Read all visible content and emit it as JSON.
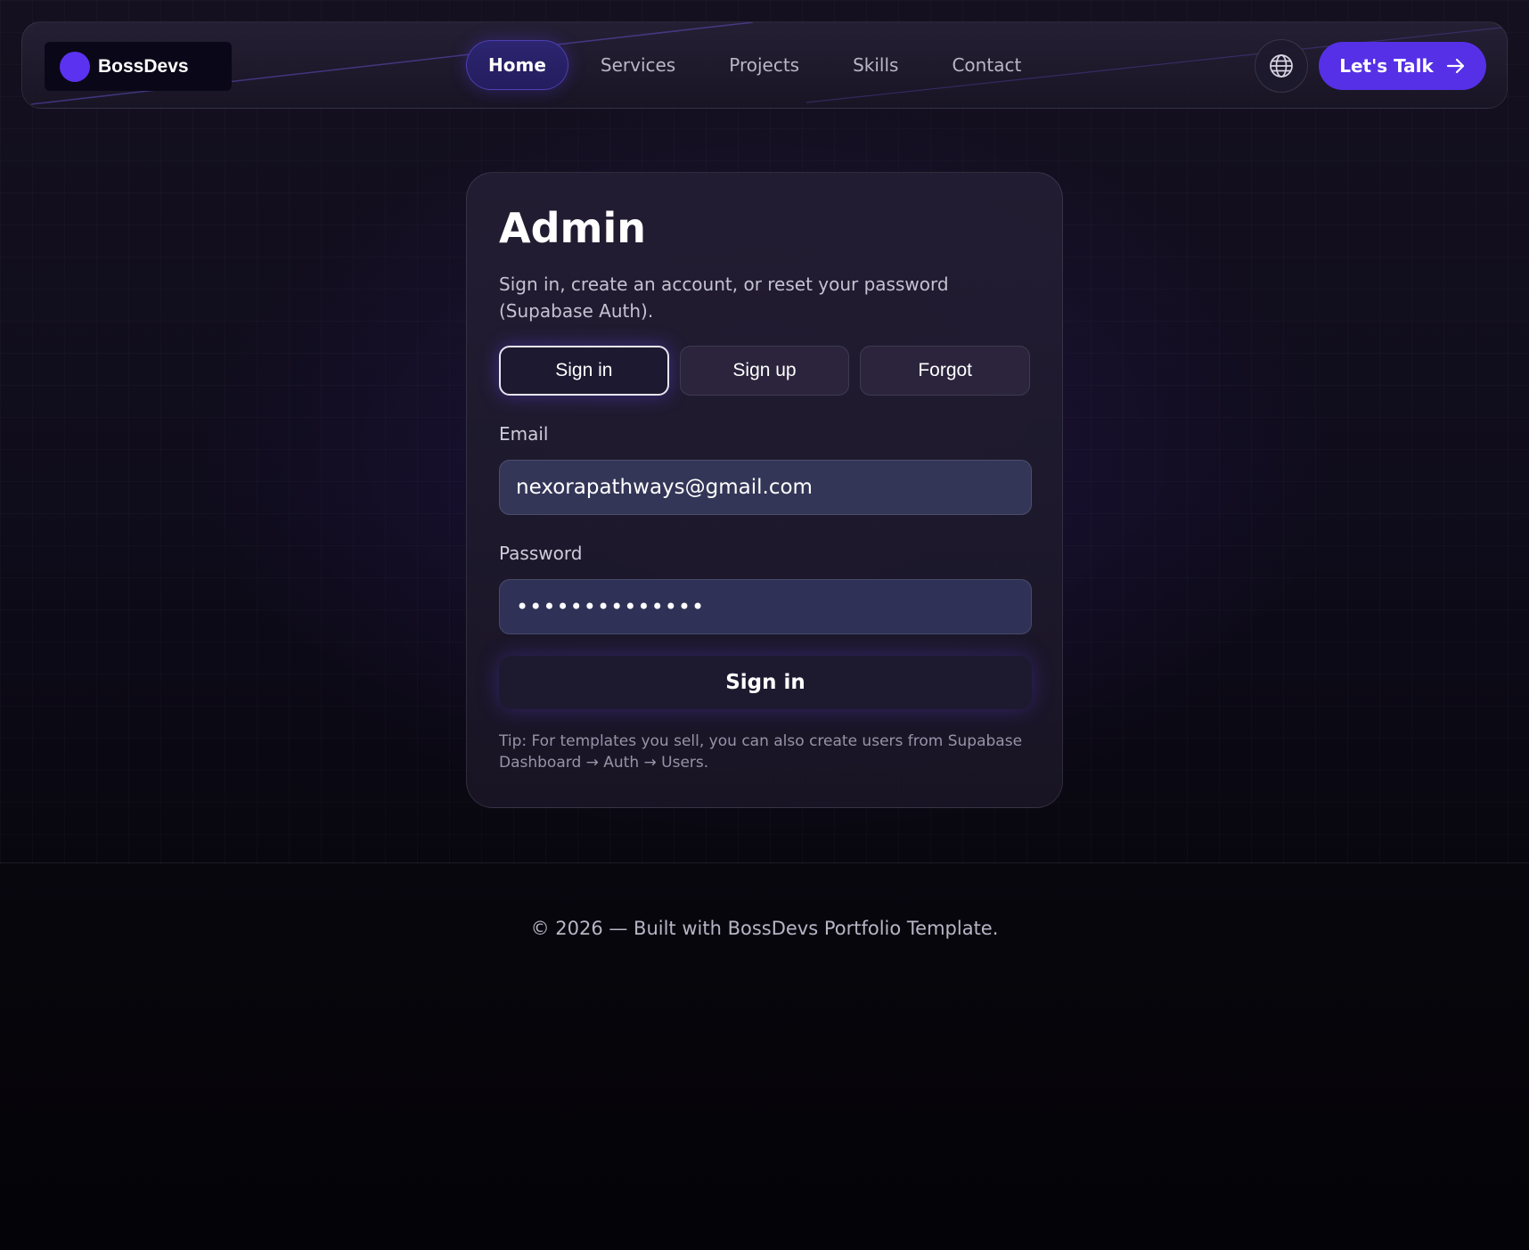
{
  "brand": {
    "name": "BossDevs",
    "accent": "#5a32ef"
  },
  "nav": {
    "links": [
      {
        "label": "Home",
        "active": true
      },
      {
        "label": "Services",
        "active": false
      },
      {
        "label": "Projects",
        "active": false
      },
      {
        "label": "Skills",
        "active": false
      },
      {
        "label": "Contact",
        "active": false
      }
    ],
    "language_icon": "globe-icon",
    "cta_label": "Let's Talk",
    "cta_icon": "arrow-right-icon",
    "cta_color": "#5630e6"
  },
  "auth": {
    "title": "Admin",
    "description": "Sign in, create an account, or reset your password (Supabase Auth).",
    "tabs": [
      {
        "label": "Sign in",
        "active": true
      },
      {
        "label": "Sign up",
        "active": false
      },
      {
        "label": "Forgot",
        "active": false
      }
    ],
    "email": {
      "label": "Email",
      "value": "nexorapathways@gmail.com"
    },
    "password": {
      "label": "Password",
      "value": "••••••••••••••"
    },
    "submit_label": "Sign in",
    "tip": "Tip: For templates you sell, you can also create users from Supabase Dashboard → Auth → Users."
  },
  "footer": {
    "text": "© 2026 — Built with BossDevs Portfolio Template."
  }
}
